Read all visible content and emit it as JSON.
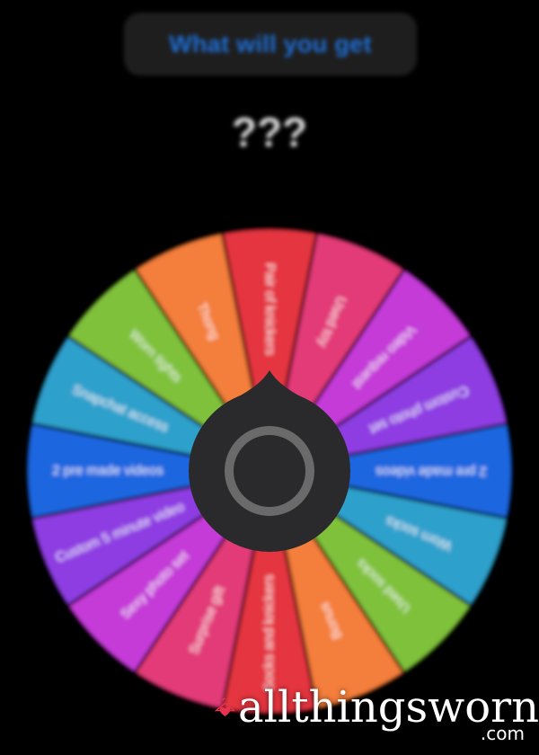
{
  "header": {
    "button_label": "What will you get"
  },
  "result": {
    "text": "???"
  },
  "wheel": {
    "segments": [
      {
        "label": "Pair of knickers",
        "color": "#e4343f"
      },
      {
        "label": "Used toy",
        "color": "#e33a78"
      },
      {
        "label": "Video request",
        "color": "#c43bd8"
      },
      {
        "label": "Custom photo set",
        "color": "#8e3ce2"
      },
      {
        "label": "2 pre made videos",
        "color": "#1a66e0"
      },
      {
        "label": "Worn socks",
        "color": "#2fa0cc"
      },
      {
        "label": "Used socks",
        "color": "#7fc13a"
      },
      {
        "label": "Bonus",
        "color": "#f47e3a"
      },
      {
        "label": "Socks and knickers",
        "color": "#e4343f"
      },
      {
        "label": "Surprise gift",
        "color": "#e33a78"
      },
      {
        "label": "Sexy photo set",
        "color": "#c43bd8"
      },
      {
        "label": "Custom 5 minute video",
        "color": "#8e3ce2"
      },
      {
        "label": "2 pre made videos",
        "color": "#1a66e0"
      },
      {
        "label": "Snapchat access",
        "color": "#2fa0cc"
      },
      {
        "label": "Worn tights",
        "color": "#7fc13a"
      },
      {
        "label": "Thong",
        "color": "#f47e3a"
      }
    ],
    "hub": {
      "color": "#2a2a2c",
      "ring_color": "#6a6a6a"
    }
  },
  "watermark": {
    "brand": "allthingsworn",
    "domain": ".com",
    "accent_color": "#e8334f"
  }
}
